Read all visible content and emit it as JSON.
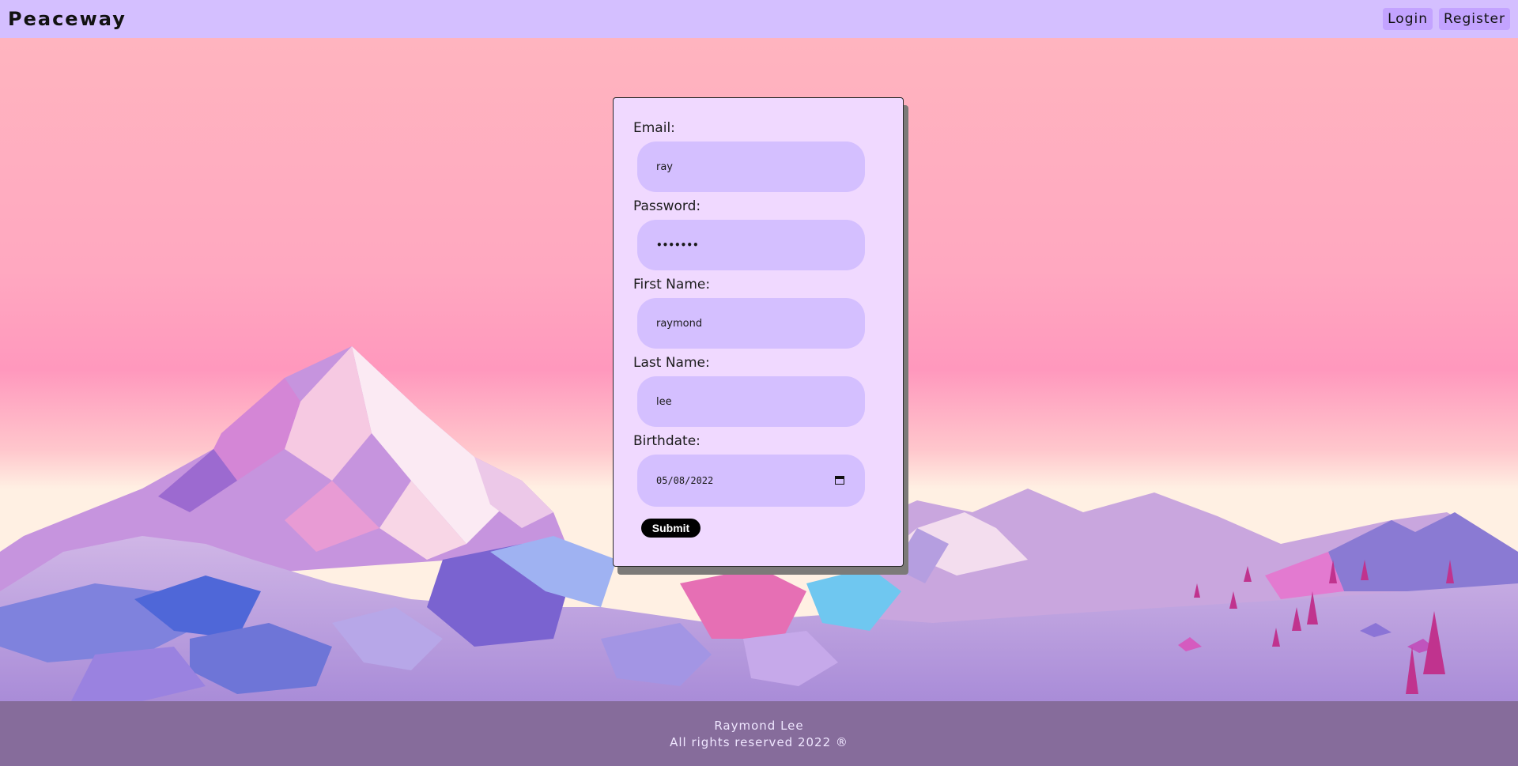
{
  "header": {
    "brand": "Peaceway",
    "nav": [
      {
        "label": "Login"
      },
      {
        "label": "Register"
      }
    ]
  },
  "form": {
    "fields": [
      {
        "label": "Email:",
        "value": "ray"
      },
      {
        "label": "Password:",
        "value": "•••••••"
      },
      {
        "label": "First Name:",
        "value": "raymond"
      },
      {
        "label": "Last Name:",
        "value": "lee"
      },
      {
        "label": "Birthdate:",
        "value": "05/08/2022"
      }
    ],
    "submit_label": "Submit"
  },
  "footer": {
    "author": "Raymond Lee",
    "rights": "All rights reserved 2022 ®"
  },
  "colors": {
    "navbar": "#d4bfff",
    "nav_button": "#c3a3ff",
    "card": "#f0d9ff",
    "input": "#d4bfff",
    "footer": "#866c9b",
    "submit": "#000000"
  }
}
